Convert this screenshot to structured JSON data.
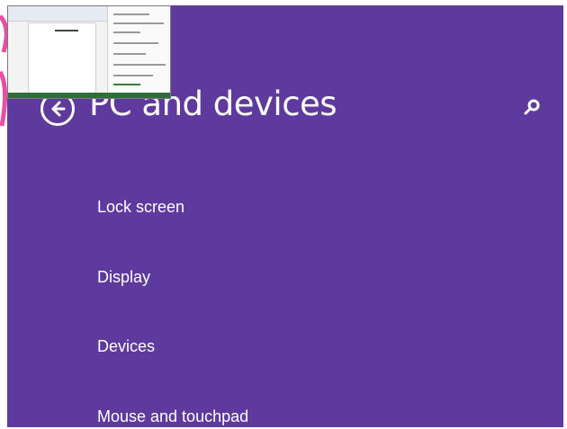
{
  "colors": {
    "background": "#5e3a9e",
    "text": "#ffffff",
    "accent": "#e64fa3"
  },
  "header": {
    "title": "PC and devices",
    "back_icon": "back-arrow-icon",
    "search_icon": "search-icon"
  },
  "nav": {
    "items": [
      {
        "label": "Lock screen"
      },
      {
        "label": "Display"
      },
      {
        "label": "Devices"
      },
      {
        "label": "Mouse and touchpad"
      }
    ]
  },
  "thumbnail": {
    "icon": "desktop-window-thumbnail"
  }
}
